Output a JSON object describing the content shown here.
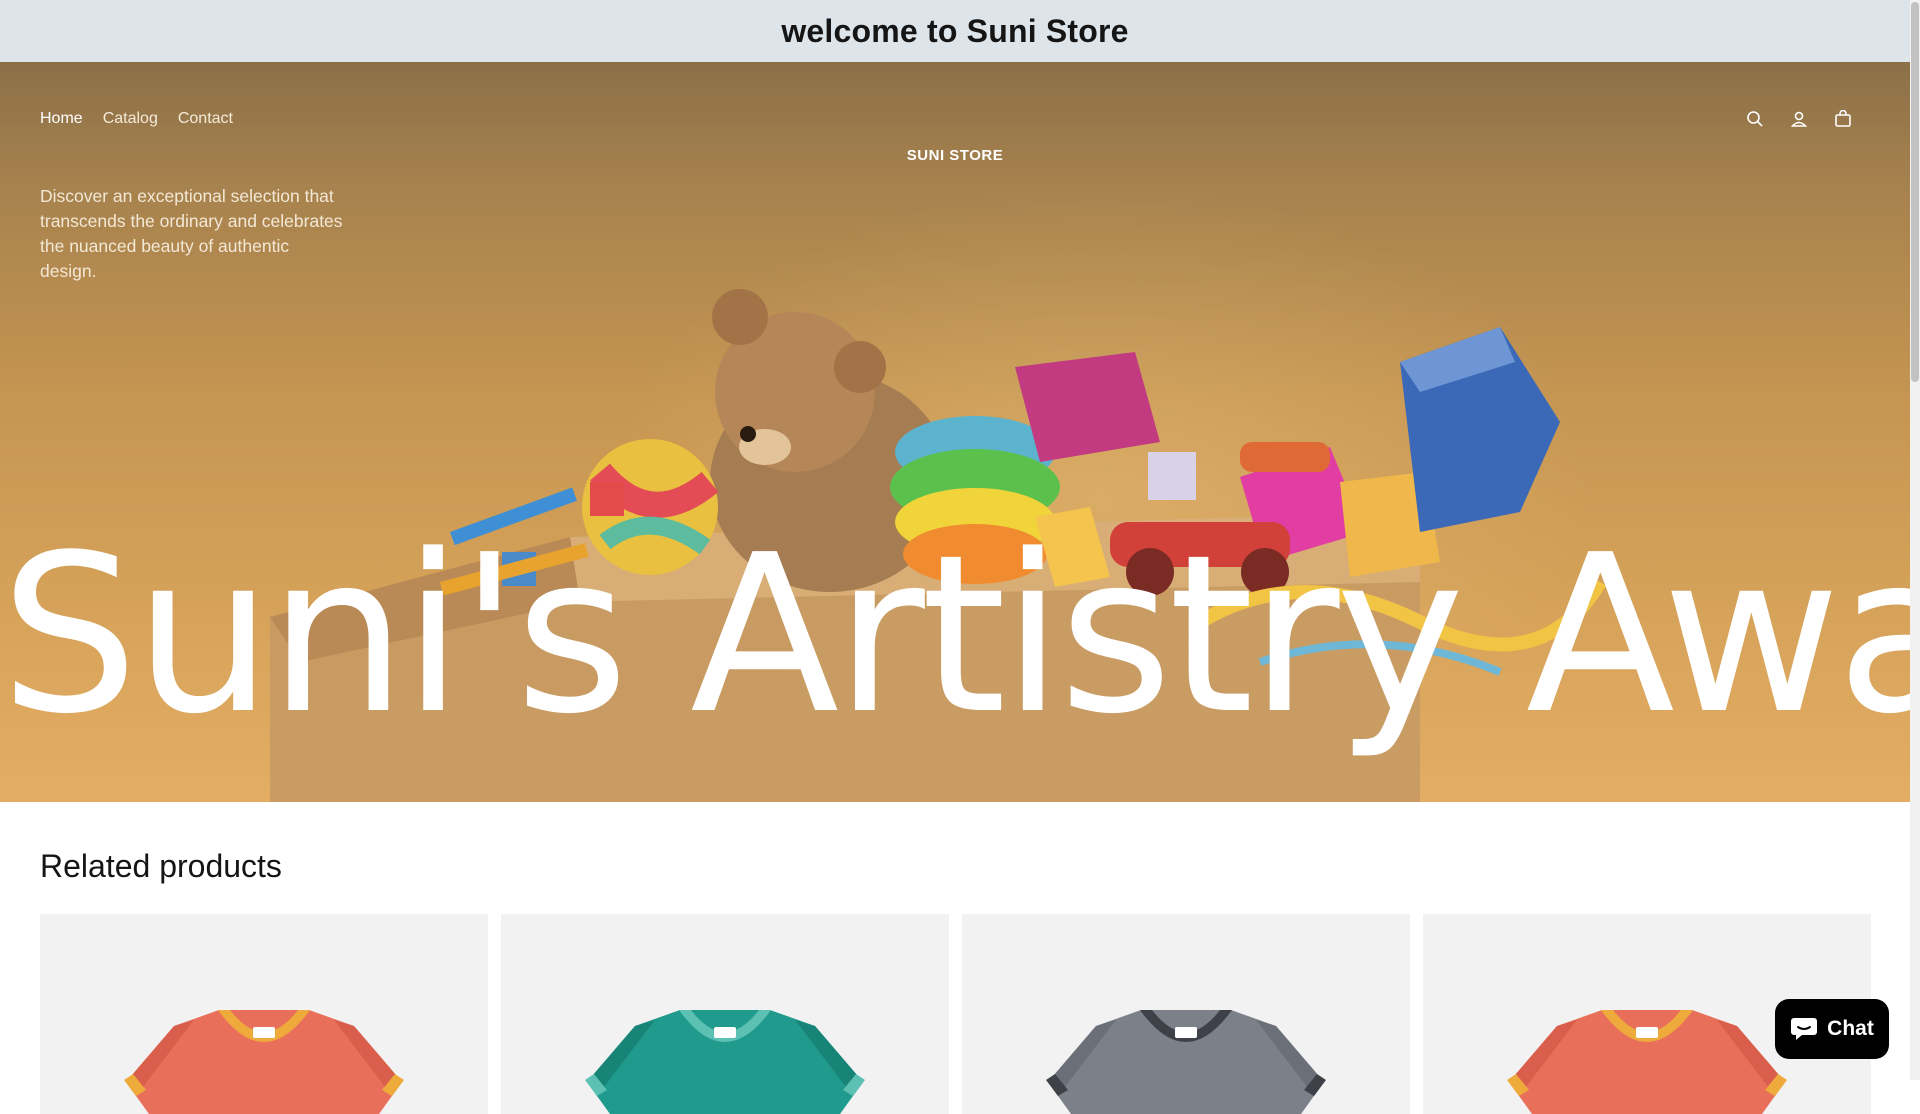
{
  "announcement": {
    "text": "welcome to Suni Store"
  },
  "header": {
    "nav": [
      {
        "label": "Home"
      },
      {
        "label": "Catalog"
      },
      {
        "label": "Contact"
      }
    ],
    "brand": "SUNI STORE",
    "icons": [
      "search-icon",
      "account-icon",
      "cart-icon"
    ]
  },
  "hero": {
    "tagline": "Discover an exceptional selection that transcends the ordinary and celebrates the nuanced beauty of authentic design.",
    "headline": "Suni's Artistry Awaits"
  },
  "related": {
    "title": "Related products",
    "cards": [
      {
        "body": "#e8705a",
        "collar": "#efaa3c",
        "shade": "#d95f4c"
      },
      {
        "body": "#1f9a8c",
        "collar": "#5cc1b3",
        "shade": "#178477"
      },
      {
        "body": "#7c8088",
        "collar": "#3e4147",
        "shade": "#6b6f77"
      },
      {
        "body": "#e8705a",
        "collar": "#efaa3c",
        "shade": "#d95f4c"
      }
    ]
  },
  "chat": {
    "label": "Chat"
  },
  "colors": {
    "announcement_bg": "#dde4ea",
    "chat_bg": "#000000"
  }
}
